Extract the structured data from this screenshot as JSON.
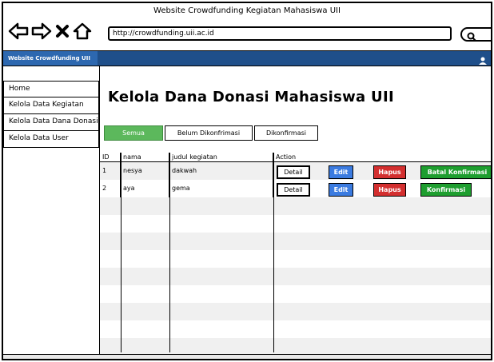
{
  "window": {
    "title": "Website Crowdfunding Kegiatan Mahasiswa UII"
  },
  "browser": {
    "url": "http://crowdfunding.uii.ac.id"
  },
  "app": {
    "brand": "Website Crowdfunding UII"
  },
  "sidebar": {
    "items": [
      {
        "label": "Home"
      },
      {
        "label": "Kelola Data Kegiatan"
      },
      {
        "label": "Kelola Data Dana Donasi"
      },
      {
        "label": "Kelola Data User"
      }
    ]
  },
  "main": {
    "title": "Kelola Dana Donasi Mahasiswa UII",
    "tabs": [
      {
        "label": "Semua"
      },
      {
        "label": "Belum Dikonfrimasi"
      },
      {
        "label": "Dikonfirmasi"
      }
    ],
    "table": {
      "headers": {
        "id": "ID",
        "nama": "nama",
        "judul": "judul kegiatan",
        "action": "Action"
      },
      "rows": [
        {
          "id": "1",
          "nama": "nesya",
          "judul": "dakwah",
          "detail": "Detail",
          "edit": "Edit",
          "hapus": "Hapus",
          "confirm": "Batal Konfirmasi"
        },
        {
          "id": "2",
          "nama": "aya",
          "judul": "gema",
          "detail": "Detail",
          "edit": "Edit",
          "hapus": "Hapus",
          "confirm": "Konfirmasi"
        }
      ]
    }
  },
  "colors": {
    "app_bar": "#1f4f8a",
    "brand_bg": "#2d68b0",
    "tab_active": "#5cb85c",
    "edit": "#3b7be0",
    "hapus": "#d32f2f",
    "confirm": "#1e9e2f"
  },
  "icons": {
    "back": "back-arrow-icon",
    "forward": "forward-arrow-icon",
    "stop": "close-icon",
    "home": "home-icon",
    "search": "search-icon",
    "user": "user-icon"
  }
}
